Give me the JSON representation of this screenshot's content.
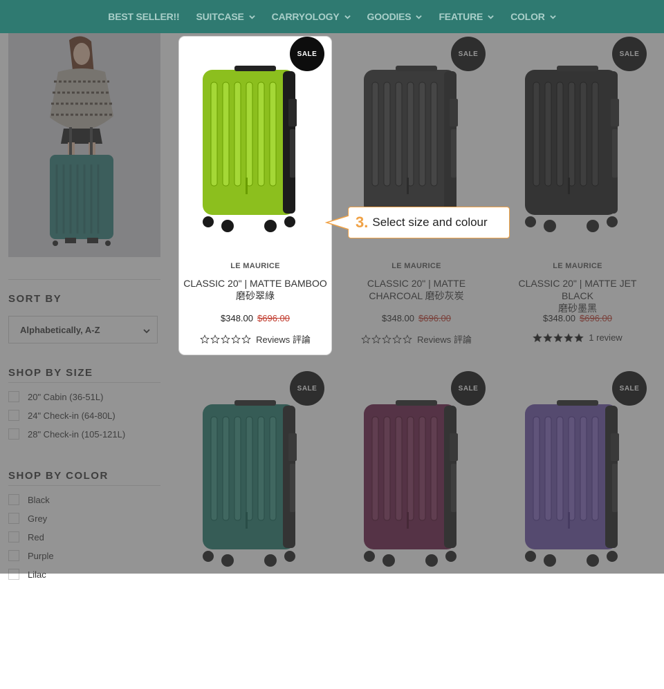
{
  "nav": {
    "items": [
      {
        "label": "BEST SELLER!!",
        "has_dropdown": false
      },
      {
        "label": "SUITCASE",
        "has_dropdown": true
      },
      {
        "label": "CARRYOLOGY",
        "has_dropdown": true
      },
      {
        "label": "GOODIES",
        "has_dropdown": true
      },
      {
        "label": "FEATURE",
        "has_dropdown": true
      },
      {
        "label": "COLOR",
        "has_dropdown": true
      }
    ],
    "background": "#2f7a71",
    "text_color": "#a9cfc9"
  },
  "sidebar": {
    "sort_title": "SORT BY",
    "sort_value": "Alphabetically, A-Z",
    "size_title": "SHOP BY SIZE",
    "sizes": [
      "20\" Cabin (36-51L)",
      "24\" Check-in (64-80L)",
      "28\" Check-in (105-121L)"
    ],
    "color_title": "SHOP BY COLOR",
    "colors": [
      "Black",
      "Grey",
      "Red",
      "Purple",
      "Lilac"
    ]
  },
  "products": [
    {
      "brand": "LE MAURICE",
      "title_line1": "CLASSIC 20\" | MATTE BAMBOO",
      "title_line2": "磨砂翠綠",
      "price": "$348.00",
      "compare_price": "$696.00",
      "rating": 0,
      "reviews_label": "Reviews 評論",
      "sale_label": "SALE",
      "swatch": "#8cbf1e"
    },
    {
      "brand": "LE MAURICE",
      "title_line1": "CLASSIC 20\" | MATTE",
      "title_line2": "CHARCOAL 磨砂灰炭",
      "price": "$348.00",
      "compare_price": "$696.00",
      "rating": 0,
      "reviews_label": "Reviews 評論",
      "sale_label": "SALE",
      "swatch": "#2c2c2c"
    },
    {
      "brand": "LE MAURICE",
      "title_line1": "CLASSIC 20\" | MATTE JET BLACK",
      "title_line2": "磨砂墨黑",
      "price": "$348.00",
      "compare_price": "$696.00",
      "rating": 5,
      "reviews_label": "1 review",
      "sale_label": "SALE",
      "swatch": "#1b1b1b"
    },
    {
      "sale_label": "SALE",
      "swatch": "#1f7a6b"
    },
    {
      "sale_label": "SALE",
      "swatch": "#6a1a45"
    },
    {
      "sale_label": "SALE",
      "swatch": "#6a4fa8"
    }
  ],
  "callout": {
    "step": "3.",
    "text": "Select size and colour"
  },
  "colors": {
    "sale_badge": "#0d0d0d",
    "compare_price": "#c0392b",
    "callout_accent": "#f0a246"
  }
}
